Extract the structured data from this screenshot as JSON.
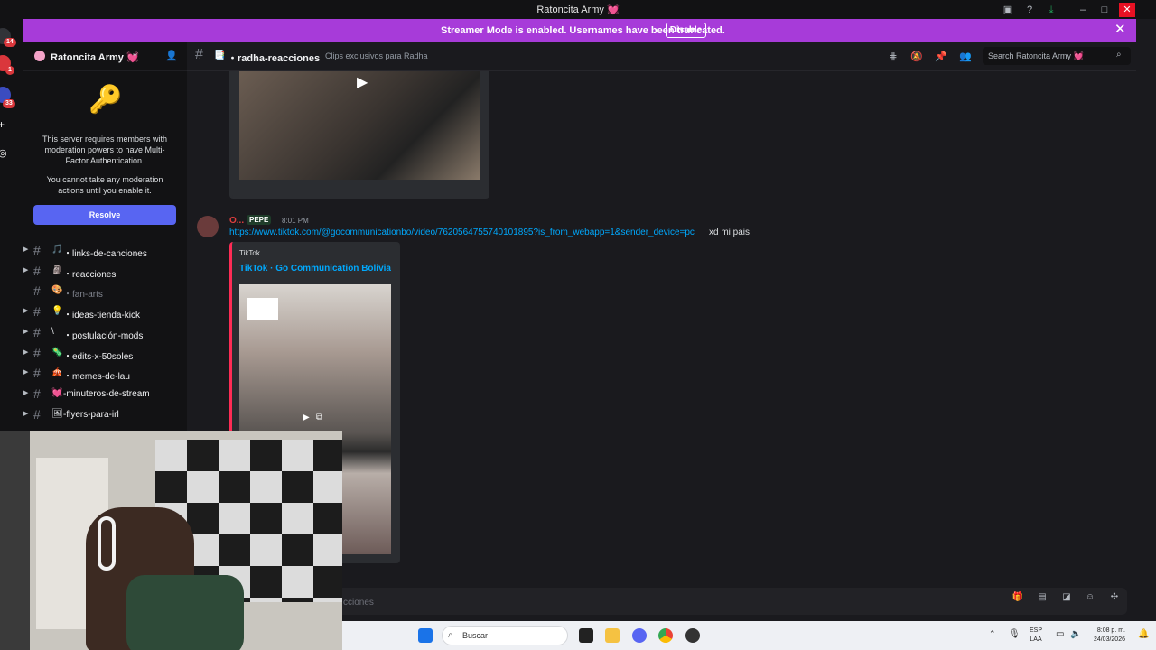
{
  "window": {
    "title": "Ratoncita Army 💓"
  },
  "banner": {
    "message": "Streamer Mode is enabled. Usernames have been truncated.",
    "disable_label": "Disable",
    "close_glyph": "✕"
  },
  "rail": {
    "badges": [
      "14",
      "1",
      "33"
    ]
  },
  "server": {
    "name": "Ratoncita Army 💓",
    "chevron": "⌄"
  },
  "mfa": {
    "message": "This server requires members with moderation powers to have Multi-Factor Authentication.",
    "sub": "You cannot take any moderation actions until you enable it.",
    "resolve_label": "Resolve"
  },
  "channels": [
    {
      "emoji": "🎵",
      "label": "・links-de-canciones",
      "muted": false,
      "arrow": true
    },
    {
      "emoji": "🗿",
      "label": "・reacciones",
      "muted": false,
      "arrow": true
    },
    {
      "emoji": "🎨",
      "label": "・fan-arts",
      "muted": true,
      "arrow": false
    },
    {
      "emoji": "💡",
      "label": "・ideas-tienda-kick",
      "muted": false,
      "arrow": true
    },
    {
      "emoji": "\\",
      "label": "・postulación-mods",
      "muted": false,
      "arrow": true
    },
    {
      "emoji": "🦠",
      "label": "・edits-x-50soles",
      "muted": false,
      "arrow": true
    },
    {
      "emoji": "🎪",
      "label": "・memes-de-lau",
      "muted": false,
      "arrow": true
    },
    {
      "emoji": "💓",
      "label": "-minuteros-de-stream",
      "muted": false,
      "arrow": true
    },
    {
      "emoji": "🖼",
      "label": "-flyers-para-irl",
      "muted": false,
      "arrow": true
    }
  ],
  "channel_header": {
    "channel_name": "・radha-reacciones",
    "topic": "Clips exclusivos para Radha",
    "search_placeholder": "Search Ratoncita Army 💓"
  },
  "message": {
    "author": "O...",
    "tag": "PEPE",
    "time": "8:01 PM",
    "link": "https://www.tiktok.com/@gocommunicationbo/video/7620564755740101895?is_from_webapp=1&sender_device=pc",
    "text": "xd mi pais",
    "embed_provider": "TikTok",
    "embed_title": "TikTok · Go Communication Bolivia"
  },
  "composer": {
    "placeholder": "cciones"
  },
  "taskbar": {
    "search_placeholder": "Buscar",
    "lang_line1": "ESP",
    "lang_line2": "LAA",
    "time": "8:08 p. m.",
    "date": "24/03/2026"
  },
  "colors": {
    "accent": "#5865f2",
    "banner": "#a73bd9",
    "link": "#00a8fc",
    "bg": "#1a1a1e"
  }
}
